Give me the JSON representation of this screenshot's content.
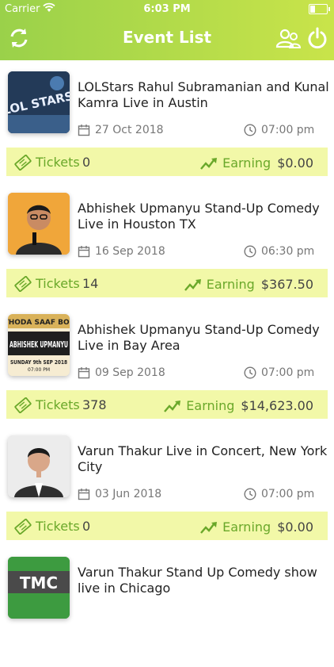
{
  "status": {
    "carrier": "Carrier",
    "time": "6:03 PM"
  },
  "header": {
    "title": "Event List"
  },
  "labels": {
    "tickets": "Tickets",
    "earning": "Earning"
  },
  "events": [
    {
      "title": "LOLStars Rahul Subramanian and Kunal Kamra Live in Austin",
      "date": "27 Oct 2018",
      "time": "07:00 pm",
      "tickets": "0",
      "earning": "$0.00"
    },
    {
      "title": "Abhishek Upmanyu Stand-Up Comedy Live in Houston TX",
      "date": "16 Sep 2018",
      "time": "06:30 pm",
      "tickets": "14",
      "earning": "$367.50"
    },
    {
      "title": "Abhishek Upmanyu Stand-Up Comedy Live in Bay Area",
      "date": "09 Sep 2018",
      "time": "07:00 pm",
      "tickets": "378",
      "earning": "$14,623.00"
    },
    {
      "title": "Varun Thakur Live in Concert, New York City",
      "date": "03 Jun 2018",
      "time": "07:00 pm",
      "tickets": "0",
      "earning": "$0.00"
    },
    {
      "title": "Varun Thakur Stand Up Comedy show live in Chicago"
    }
  ],
  "thumb_text": {
    "lol_poster": "LOL STARS",
    "bay_poster_top": "THODA SAAF BOL",
    "bay_poster_name": "ABHISHEK UPMANYU",
    "bay_poster_date": "SUNDAY 9th SEP 2018",
    "bay_poster_time": "07:00 PM",
    "chicago_poster": "TMC"
  },
  "colors": {
    "header_start": "#9ad14a",
    "header_end": "#c9e44a",
    "stats_bg": "#f2f8a8",
    "accent_green": "#6aa82a"
  }
}
